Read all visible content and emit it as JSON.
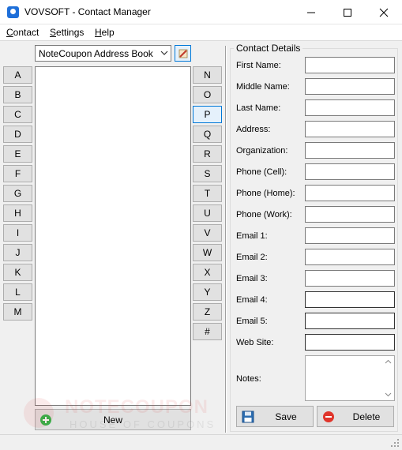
{
  "window": {
    "title": "VOVSOFT - Contact Manager"
  },
  "menu": {
    "contact": {
      "underlined": "C",
      "rest": "ontact"
    },
    "settings": {
      "underlined": "S",
      "rest": "ettings"
    },
    "help": {
      "underlined": "H",
      "rest": "elp"
    }
  },
  "address_book": {
    "selected": "NoteCoupon Address Book"
  },
  "letters_left": [
    "A",
    "B",
    "C",
    "D",
    "E",
    "F",
    "G",
    "H",
    "I",
    "J",
    "K",
    "L",
    "M"
  ],
  "letters_right": [
    "N",
    "O",
    "P",
    "Q",
    "R",
    "S",
    "T",
    "U",
    "V",
    "W",
    "X",
    "Y",
    "Z",
    "#"
  ],
  "active_letter": "P",
  "contact_list": {
    "items": [],
    "new_label": "New"
  },
  "details": {
    "group_title": "Contact Details",
    "fields": [
      {
        "label": "First Name:",
        "value": ""
      },
      {
        "label": "Middle Name:",
        "value": ""
      },
      {
        "label": "Last Name:",
        "value": ""
      },
      {
        "label": "Address:",
        "value": ""
      },
      {
        "label": "Organization:",
        "value": ""
      },
      {
        "label": "Phone (Cell):",
        "value": ""
      },
      {
        "label": "Phone (Home):",
        "value": ""
      },
      {
        "label": "Phone (Work):",
        "value": ""
      },
      {
        "label": "Email 1:",
        "value": ""
      },
      {
        "label": "Email 2:",
        "value": ""
      },
      {
        "label": "Email 3:",
        "value": ""
      },
      {
        "label": "Email 4:",
        "value": ""
      },
      {
        "label": "Email 5:",
        "value": ""
      },
      {
        "label": "Web Site:",
        "value": ""
      }
    ],
    "notes_label": "Notes:",
    "notes_value": "",
    "save_label": "Save",
    "delete_label": "Delete"
  },
  "watermark": {
    "brand": "NOTECOUPON",
    "tagline": "HOUSE OF COUPONS"
  },
  "colors": {
    "accent": "#0078d7",
    "button_face": "#e1e1e1",
    "window_bg": "#f0f0f0",
    "add_green": "#2fb64a",
    "delete_red": "#e0352b"
  }
}
